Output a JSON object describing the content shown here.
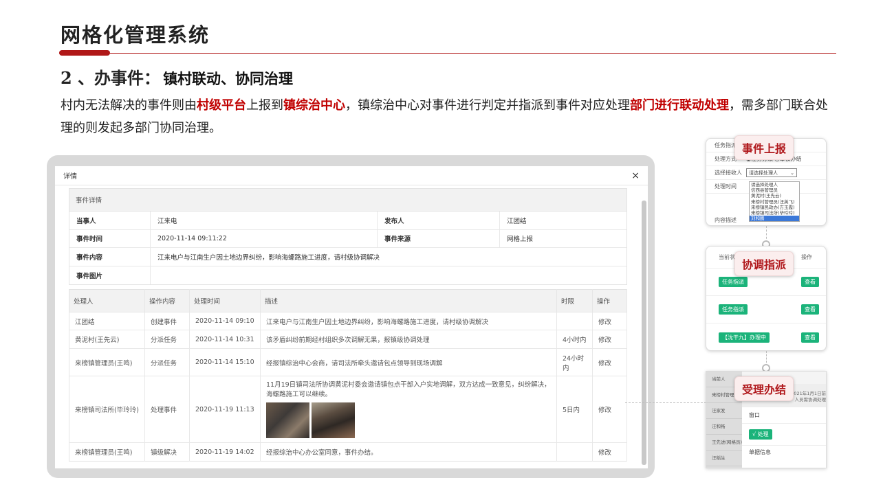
{
  "header": {
    "title": "网格化管理系统"
  },
  "section": {
    "number": "2 、办事件：",
    "subtitle": "镇村联动、协同治理"
  },
  "paragraph": [
    {
      "t": "村内无法解决的事件则由",
      "hl": false
    },
    {
      "t": "村级平台",
      "hl": true
    },
    {
      "t": "上报到",
      "hl": false
    },
    {
      "t": "镇综治中心",
      "hl": true
    },
    {
      "t": "，镇综治中心对事件进行判定并指派到事件对应处理",
      "hl": false
    },
    {
      "t": "部门进行联动处理",
      "hl": true
    },
    {
      "t": "，需多部门联合处理的则发起多部门协同治理。",
      "hl": false
    }
  ],
  "dialog": {
    "title": "详情",
    "close": "×",
    "detail": {
      "heading": "事件详情",
      "party_label": "当事人",
      "party_value": "江来电",
      "publisher_label": "发布人",
      "publisher_value": "江团结",
      "time_label": "事件时间",
      "time_value": "2020-11-14 09:11:22",
      "source_label": "事件来源",
      "source_value": "网格上报",
      "content_label": "事件内容",
      "content_value": "江来电户与江南生户因土地边界纠纷，影响海螺路施工进度，请村级协调解决",
      "images_label": "事件图片"
    },
    "table": {
      "headers": [
        "处理人",
        "操作内容",
        "处理时间",
        "描述",
        "时限",
        "操作"
      ],
      "rows": [
        {
          "handler": "江团结",
          "op": "创建事件",
          "time": "2020-11-14 09:10",
          "desc": "江来电户与江南生户因土地边界纠纷，影响海螺路施工进度，请村级协调解决",
          "limit": "",
          "action": "修改"
        },
        {
          "handler": "黄泥村(王先云)",
          "op": "分派任务",
          "time": "2020-11-14 10:31",
          "desc": "该矛盾纠纷前期经村组织多次调解无果，报镇级协调处理",
          "limit": "4小时内",
          "action": "修改"
        },
        {
          "handler": "来榜镇管理员(王鸣)",
          "op": "分派任务",
          "time": "2020-11-14 15:10",
          "desc": "经报镇综治中心会商，请司法所牵头邀请包点领导到现场调解",
          "limit": "24小时内",
          "action": "修改"
        },
        {
          "handler": "来榜镇司法所(毕玲玲)",
          "op": "处理事件",
          "time": "2020-11-19 11:13",
          "desc": "11月19日镇司法所协调黄泥村委会邀请镇包点干部入户实地调解，双方达成一致意见，纠纷解决，海螺路施工可以继续。",
          "limit": "5日内",
          "action": "修改"
        },
        {
          "handler": "来榜镇管理员(王鸣)",
          "op": "镇级解决",
          "time": "2020-11-19 14:02",
          "desc": "经报综治中心办公室同意，事件办结。",
          "limit": "",
          "action": "修改"
        }
      ]
    }
  },
  "cards": {
    "report": {
      "banner": "事件上报",
      "r0": "任务指派",
      "r1_label": "处理方式",
      "r1_opt1": "◉任务分派",
      "r1_opt2": "○审核办结",
      "r2_label": "选择接收人",
      "r2_select": "请选择处理人",
      "r3_label": "处理时间",
      "r4_label": "内容描述",
      "options": [
        "请选择处理人",
        "信西县管理员",
        "黄泥村(王先云)",
        "来榜村管理员(汪英飞)",
        "来榜镇民政办(方玉霞)",
        "来榜镇司法所(毕玲玲)",
        "刘和鹏"
      ]
    },
    "assign": {
      "banner": "协调指派",
      "col1": "当前状态",
      "col2": "操作",
      "rows": [
        {
          "status": "任务指派",
          "action": "查看"
        },
        {
          "status": "任务指派",
          "action": "查看"
        },
        {
          "status": "【沈干九】办理中",
          "action": "查看"
        }
      ]
    },
    "close": {
      "banner": "受理办结",
      "side": [
        "当前人",
        "来榜村管理",
        "汪家发",
        "汪和畅",
        "王先进(网格员)",
        "汪稻生"
      ],
      "note1": "2021年1月1日前",
      "note2": "人员需协调处理",
      "window_label": "窗口",
      "process_btn": "√ 处理",
      "info_label": "单据信息"
    }
  },
  "colors": {
    "accent": "#b01818",
    "green": "#1bb37a"
  }
}
